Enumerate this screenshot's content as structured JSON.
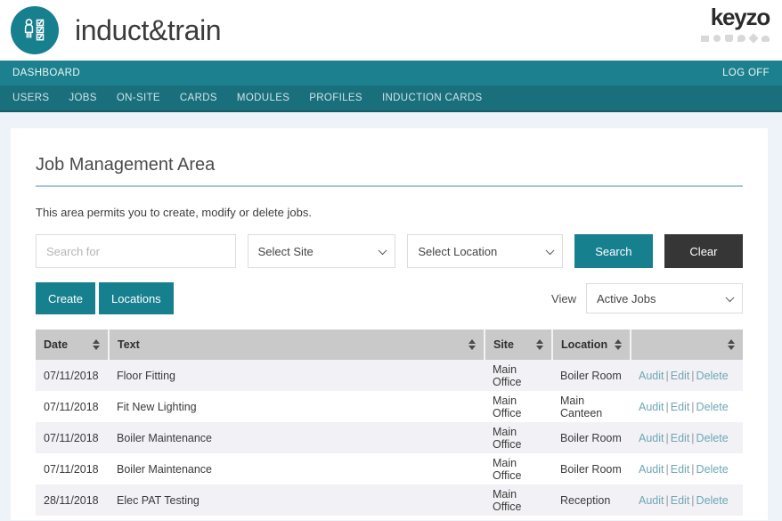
{
  "brand": {
    "logo_icon": "person-checklist-icon",
    "name": "induct&train",
    "partner_name": "keyzo",
    "partner_icons": [
      "square-icon",
      "circle-icon",
      "cart-icon",
      "chat-icon",
      "pencil-icon",
      "cloud-icon"
    ]
  },
  "nav": {
    "dashboard_label": "DASHBOARD",
    "logoff_label": "LOG OFF",
    "items": [
      {
        "label": "USERS"
      },
      {
        "label": "JOBS"
      },
      {
        "label": "ON-SITE"
      },
      {
        "label": "CARDS"
      },
      {
        "label": "MODULES"
      },
      {
        "label": "PROFILES"
      },
      {
        "label": "INDUCTION CARDS"
      }
    ]
  },
  "main": {
    "title": "Job Management Area",
    "lead": "This area permits you to create, modify or delete jobs.",
    "filters": {
      "search_placeholder": "Search for",
      "search_value": "",
      "site_select_value": "Select Site",
      "location_select_value": "Select Location",
      "search_button": "Search",
      "clear_button": "Clear"
    },
    "actions": {
      "create_button": "Create",
      "locations_button": "Locations",
      "view_label": "View",
      "view_select_value": "Active Jobs"
    },
    "table": {
      "headers": {
        "date": "Date",
        "text": "Text",
        "site": "Site",
        "location": "Location",
        "actions": ""
      },
      "row_actions": {
        "audit": "Audit",
        "edit": "Edit",
        "delete": "Delete",
        "separator": "|"
      },
      "rows": [
        {
          "date": "07/11/2018",
          "text": "Floor Fitting",
          "site": "Main Office",
          "location": "Boiler Room"
        },
        {
          "date": "07/11/2018",
          "text": "Fit New Lighting",
          "site": "Main Office",
          "location": "Main Canteen"
        },
        {
          "date": "07/11/2018",
          "text": "Boiler Maintenance",
          "site": "Main Office",
          "location": "Boiler Room"
        },
        {
          "date": "07/11/2018",
          "text": "Boiler Maintenance",
          "site": "Main Office",
          "location": "Boiler Room"
        },
        {
          "date": "28/11/2018",
          "text": "Elec PAT Testing",
          "site": "Main Office",
          "location": "Reception"
        }
      ]
    }
  },
  "colors": {
    "teal_primary": "#17808f",
    "teal_dark": "#1a6f7c",
    "dark_button": "#363636",
    "link_teal": "#6ea7b4",
    "page_bg": "#eef3fa",
    "table_header": "#c9c9c9",
    "row_alt": "#f2f1f6"
  }
}
